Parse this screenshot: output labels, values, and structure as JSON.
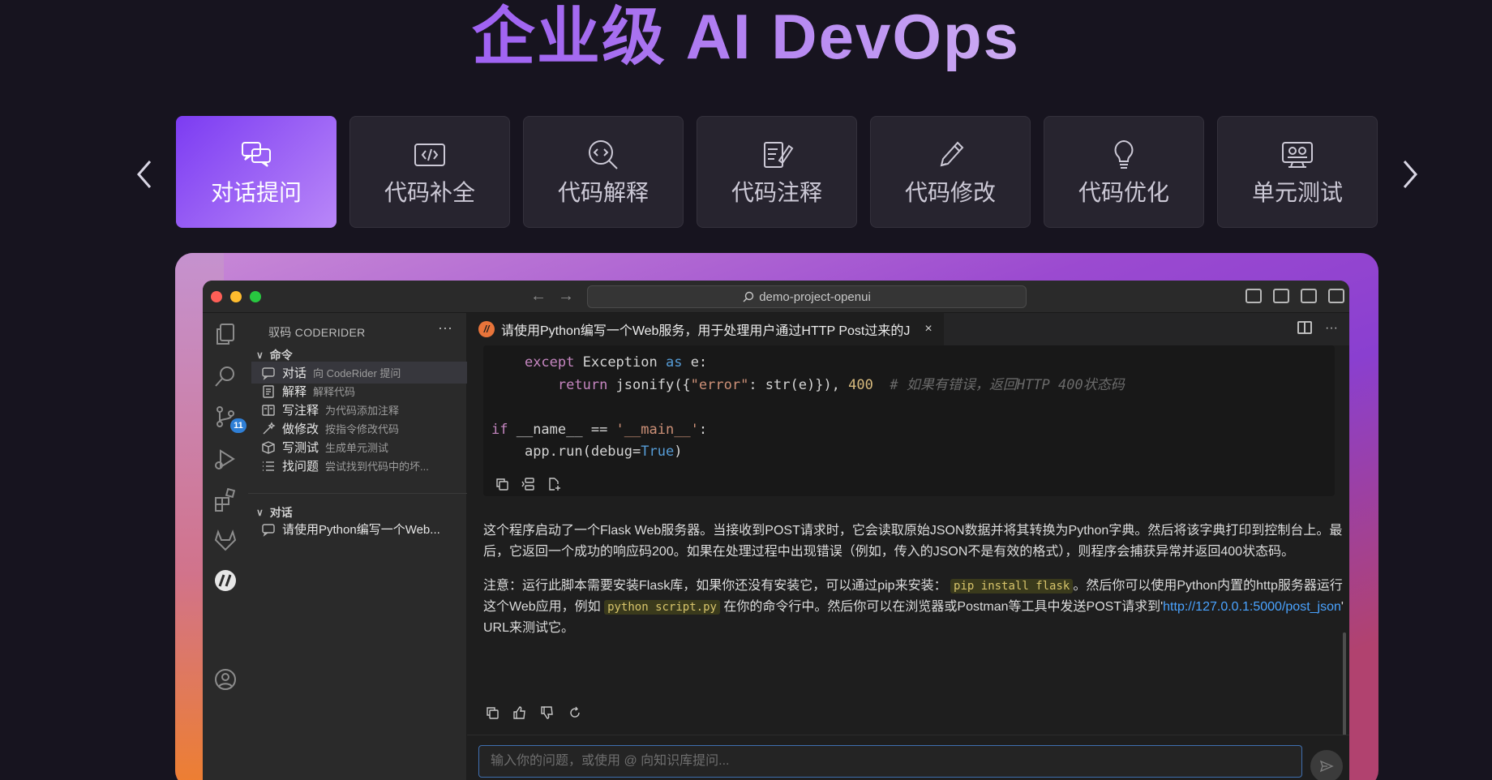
{
  "hero": {
    "title": "企业级 AI DevOps"
  },
  "tabs": [
    {
      "label": "对话提问",
      "icon": "chat-bubbles-icon",
      "active": true
    },
    {
      "label": "代码补全",
      "icon": "code-brackets-icon"
    },
    {
      "label": "代码解释",
      "icon": "code-search-icon"
    },
    {
      "label": "代码注释",
      "icon": "edit-note-icon"
    },
    {
      "label": "代码修改",
      "icon": "pencil-icon"
    },
    {
      "label": "代码优化",
      "icon": "lightbulb-icon"
    },
    {
      "label": "单元测试",
      "icon": "test-monitor-icon"
    }
  ],
  "ide": {
    "search": "demo-project-openui",
    "sidebar": {
      "header": "驭码 CODERIDER",
      "more": "···",
      "commands_section": "命令",
      "commands": [
        {
          "name": "对话",
          "desc": "向 CodeRider 提问",
          "icon": "chat-icon"
        },
        {
          "name": "解释",
          "desc": "解释代码",
          "icon": "book-icon"
        },
        {
          "name": "写注释",
          "desc": "为代码添加注释",
          "icon": "columns-icon"
        },
        {
          "name": "做修改",
          "desc": "按指令修改代码",
          "icon": "wand-icon"
        },
        {
          "name": "写测试",
          "desc": "生成单元测试",
          "icon": "cube-icon"
        },
        {
          "name": "找问题",
          "desc": "尝试找到代码中的坏...",
          "icon": "list-icon"
        }
      ],
      "chats_section": "对话",
      "chats": [
        {
          "title": "请使用Python编写一个Web..."
        }
      ],
      "source_control_badge": "11"
    },
    "editor": {
      "tab_title": "请使用Python编写一个Web服务，用于处理用户通过HTTP Post过来的J",
      "tab_logo": "//",
      "close": "×",
      "more": "···",
      "code": {
        "line1_kw": "except",
        "line1_rest": " Exception ",
        "line1_as": "as",
        "line1_end": " e:",
        "line2_kw": "return",
        "line2_mid": " jsonify({",
        "line2_str": "\"error\"",
        "line2_mid2": ": str(e)}), ",
        "line2_num": "400",
        "line2_comment": "# 如果有错误，返回HTTP 400状态码",
        "line4_kw": "if",
        "line4_mid": " __name__ == ",
        "line4_str": "'__main__'",
        "line4_end": ":",
        "line5_start": "app.run(debug=",
        "line5_kw": "True",
        "line5_end": ")"
      },
      "answer_p1": "这个程序启动了一个Flask Web服务器。当接收到POST请求时，它会读取原始JSON数据并将其转换为Python字典。然后将该字典打印到控制台上。最后，它返回一个成功的响应码200。如果在处理过程中出现错误（例如，传入的JSON不是有效的格式），则程序会捕获异常并返回400状态码。",
      "answer_p2_a": "注意：运行此脚本需要安装Flask库，如果你还没有安装它，可以通过pip来安装：",
      "answer_p2_code1": "pip install flask",
      "answer_p2_b": "。然后你可以使用Python内置的http服务器运行这个Web应用，例如",
      "answer_p2_code2": "python script.py",
      "answer_p2_c": "在你的命令行中。然后你可以在浏览器或Postman等工具中发送POST请求到'",
      "answer_p2_link": "http://127.0.0.1:5000/post_json",
      "answer_p2_d": "' URL来测试它。",
      "input_placeholder": "输入你的问题，或使用 @ 向知识库提问..."
    }
  },
  "colors": {
    "accent": "#7c3cf2",
    "background": "#17141f",
    "ide_bg": "#1e1e1e"
  }
}
